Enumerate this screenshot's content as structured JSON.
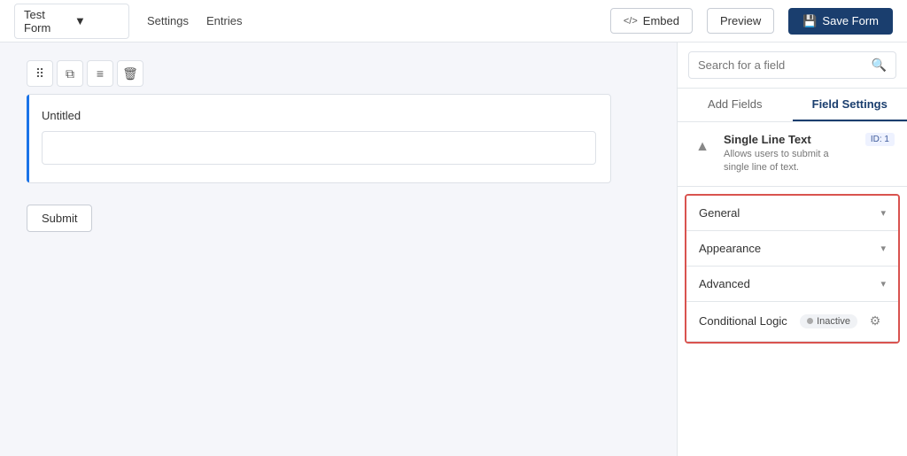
{
  "topbar": {
    "form_name": "Test Form",
    "nav": [
      "Settings",
      "Entries"
    ],
    "embed_label": "Embed",
    "preview_label": "Preview",
    "save_label": "Save Form"
  },
  "canvas": {
    "field_label": "Untitled",
    "field_placeholder": "",
    "submit_label": "Submit"
  },
  "toolbar": {
    "drag_icon": "⠿",
    "copy_icon": "⧉",
    "settings_icon": "≡",
    "delete_icon": "🗑"
  },
  "right_panel": {
    "search_placeholder": "Search for a field",
    "tabs": [
      {
        "id": "add-fields",
        "label": "Add Fields",
        "active": false
      },
      {
        "id": "field-settings",
        "label": "Field Settings",
        "active": true
      }
    ],
    "field_info": {
      "type_name": "Single Line Text",
      "type_desc": "Allows users to submit a single line of text.",
      "id_badge": "ID: 1"
    },
    "sections": [
      {
        "id": "general",
        "label": "General"
      },
      {
        "id": "appearance",
        "label": "Appearance"
      },
      {
        "id": "advanced",
        "label": "Advanced"
      }
    ],
    "conditional_logic": {
      "label": "Conditional Logic",
      "badge": "Inactive"
    }
  }
}
